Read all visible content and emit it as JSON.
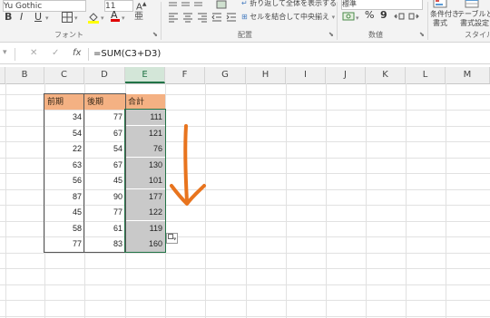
{
  "ribbon": {
    "font_name": "Yu Gothic",
    "font_size": "11",
    "bold": "B",
    "italic": "I",
    "underline": "U",
    "border_icon": "border-icon",
    "fill_icon": "fill-color-icon",
    "font_color_letter": "A",
    "furigana": "亜",
    "wrap_text": "折り返して全体を表示する",
    "merge_center": "セルを結合して中央揃え",
    "number_format": "標準",
    "percent": "%",
    "comma": "9",
    "conditional_format": [
      "条件付き",
      "書式"
    ],
    "table_format": [
      "テーブルとし",
      "書式設定"
    ],
    "groups": {
      "font": "フォント",
      "alignment": "配置",
      "number": "数値",
      "style": "スタイル"
    }
  },
  "formula_bar": {
    "cancel": "✕",
    "enter": "✓",
    "fx": "fx",
    "formula": "=SUM(C3+D3)"
  },
  "columns": [
    "B",
    "C",
    "D",
    "E",
    "F",
    "G",
    "H",
    "I",
    "J",
    "K",
    "L",
    "M"
  ],
  "selected_column": "E",
  "table": {
    "headers": [
      "前期",
      "後期",
      "合計"
    ],
    "rows": [
      [
        "34",
        "77",
        "111"
      ],
      [
        "54",
        "67",
        "121"
      ],
      [
        "22",
        "54",
        "76"
      ],
      [
        "63",
        "67",
        "130"
      ],
      [
        "56",
        "45",
        "101"
      ],
      [
        "87",
        "90",
        "177"
      ],
      [
        "45",
        "77",
        "122"
      ],
      [
        "58",
        "61",
        "119"
      ],
      [
        "77",
        "83",
        "160"
      ]
    ]
  },
  "colors": {
    "header_fill": "#f4b183",
    "selection_fill": "#c9c9c9",
    "arrow": "#e8741e",
    "excel_green": "#217346"
  }
}
